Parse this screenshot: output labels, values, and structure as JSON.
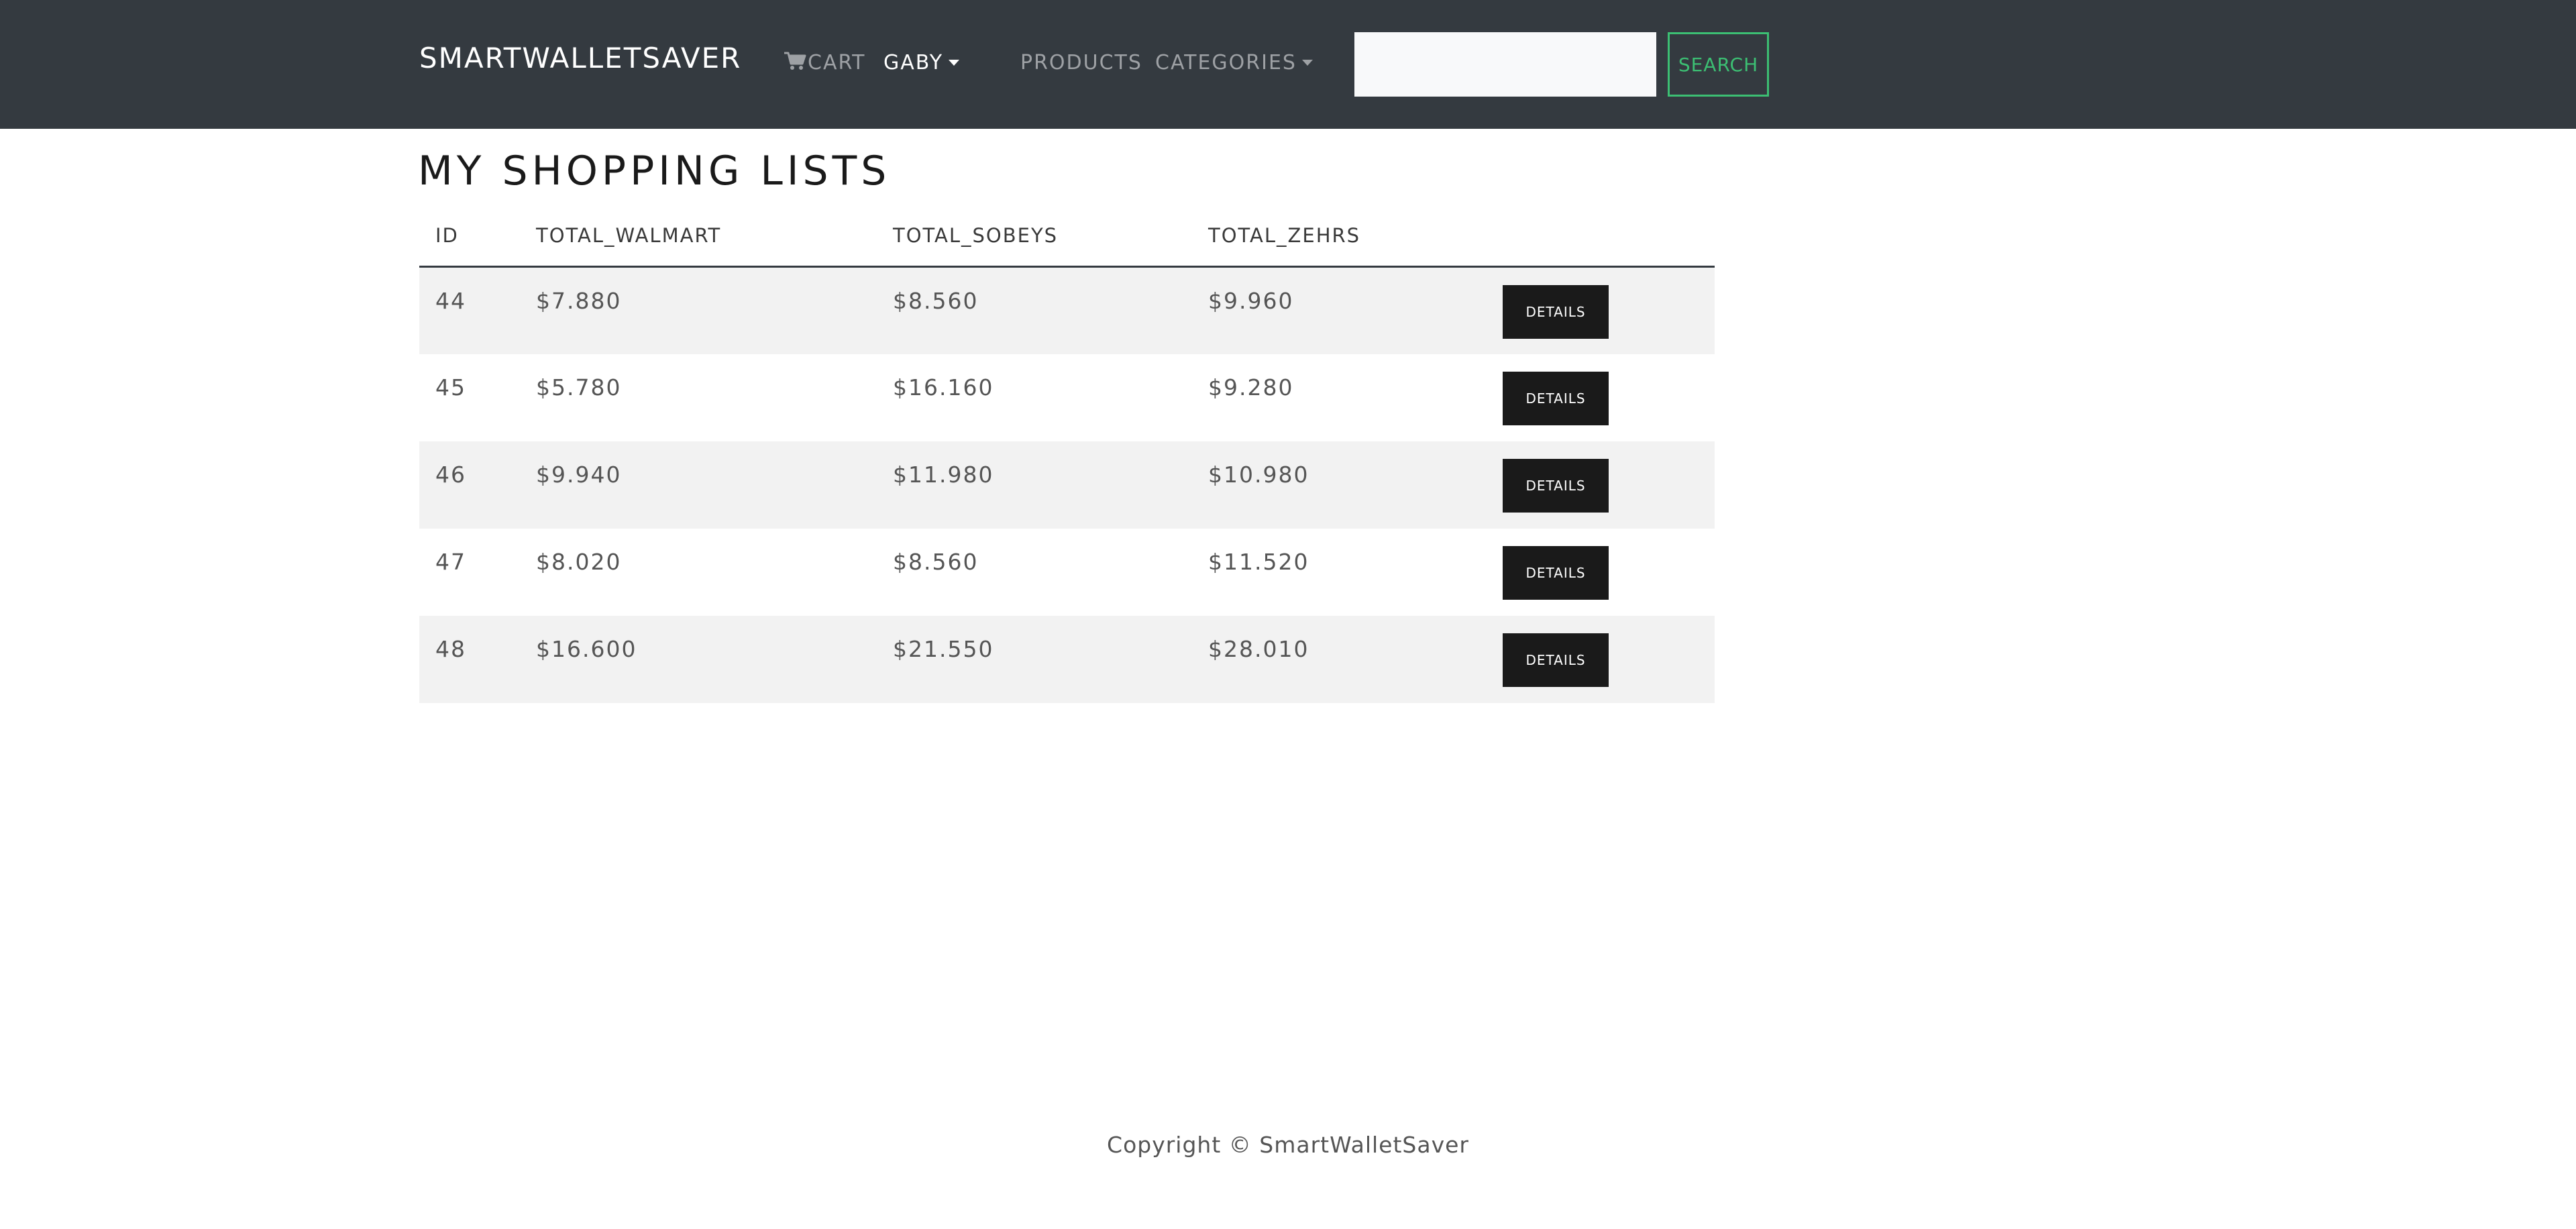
{
  "navbar": {
    "brand": "SmartWalletSaver",
    "cart_label": "Cart",
    "user_label": "Gaby",
    "products_label": "Products",
    "categories_label": "Categories",
    "search_placeholder": "",
    "search_button": "Search",
    "accent_color": "#3cbf73",
    "background_color": "#343a40"
  },
  "main": {
    "title": "My Shopping Lists",
    "table": {
      "headers": [
        "ID",
        "TOTAL_WALMART",
        "TOTAL_SOBEYS",
        "TOTAL_ZEHRS",
        ""
      ],
      "rows": [
        {
          "id": "44",
          "walmart": "$7.880",
          "sobeys": "$8.560",
          "zehrs": "$9.960",
          "action": "Details"
        },
        {
          "id": "45",
          "walmart": "$5.780",
          "sobeys": "$16.160",
          "zehrs": "$9.280",
          "action": "Details"
        },
        {
          "id": "46",
          "walmart": "$9.940",
          "sobeys": "$11.980",
          "zehrs": "$10.980",
          "action": "Details"
        },
        {
          "id": "47",
          "walmart": "$8.020",
          "sobeys": "$8.560",
          "zehrs": "$11.520",
          "action": "Details"
        },
        {
          "id": "48",
          "walmart": "$16.600",
          "sobeys": "$21.550",
          "zehrs": "$28.010",
          "action": "Details"
        }
      ]
    }
  },
  "footer": {
    "copyright": "Copyright © SmartWalletSaver"
  },
  "icons": {
    "cart": "shopping-cart-icon",
    "dropdown": "caret-down-icon"
  }
}
